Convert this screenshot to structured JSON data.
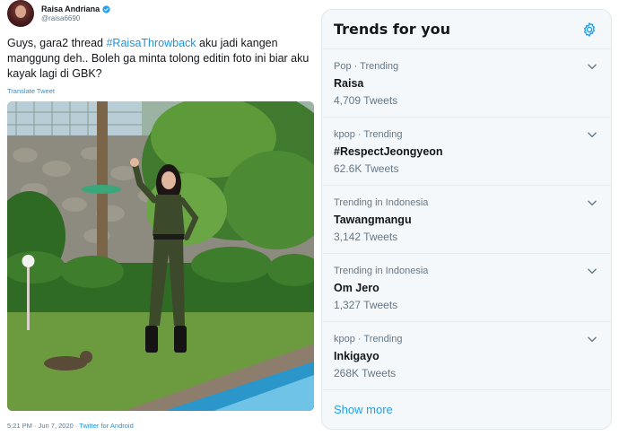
{
  "tweet": {
    "author": {
      "display_name": "Raisa Andriana",
      "handle": "@raisa6690"
    },
    "text": {
      "part1": "Guys, gara2 thread ",
      "hashtag": "#RaisaThrowback",
      "part2": " aku jadi kangen manggung deh.. Boleh ga minta tolong editin foto ini biar aku kayak lagi di GBK?"
    },
    "translate_label": "Translate Tweet",
    "timestamp": "5:21 PM · Jun 7, 2020",
    "separator": "·",
    "source": "Twitter for Android"
  },
  "trends": {
    "title": "Trends for you",
    "items": [
      {
        "context": "Pop · Trending",
        "name": "Raisa",
        "count": "4,709 Tweets"
      },
      {
        "context": "kpop · Trending",
        "name": "#RespectJeongyeon",
        "count": "62.6K Tweets"
      },
      {
        "context": "Trending in Indonesia",
        "name": "Tawangmangu",
        "count": "3,142 Tweets"
      },
      {
        "context": "Trending in Indonesia",
        "name": "Om Jero",
        "count": "1,327 Tweets"
      },
      {
        "context": "kpop · Trending",
        "name": "Inkigayo",
        "count": "268K Tweets"
      }
    ],
    "show_more_label": "Show more"
  },
  "colors": {
    "accent": "#1da1f2",
    "link": "#1b95e0",
    "muted": "#657786",
    "panel_bg": "#f5f8fa"
  },
  "icons": [
    "verified-icon",
    "gear-icon",
    "chevron-down-icon"
  ]
}
